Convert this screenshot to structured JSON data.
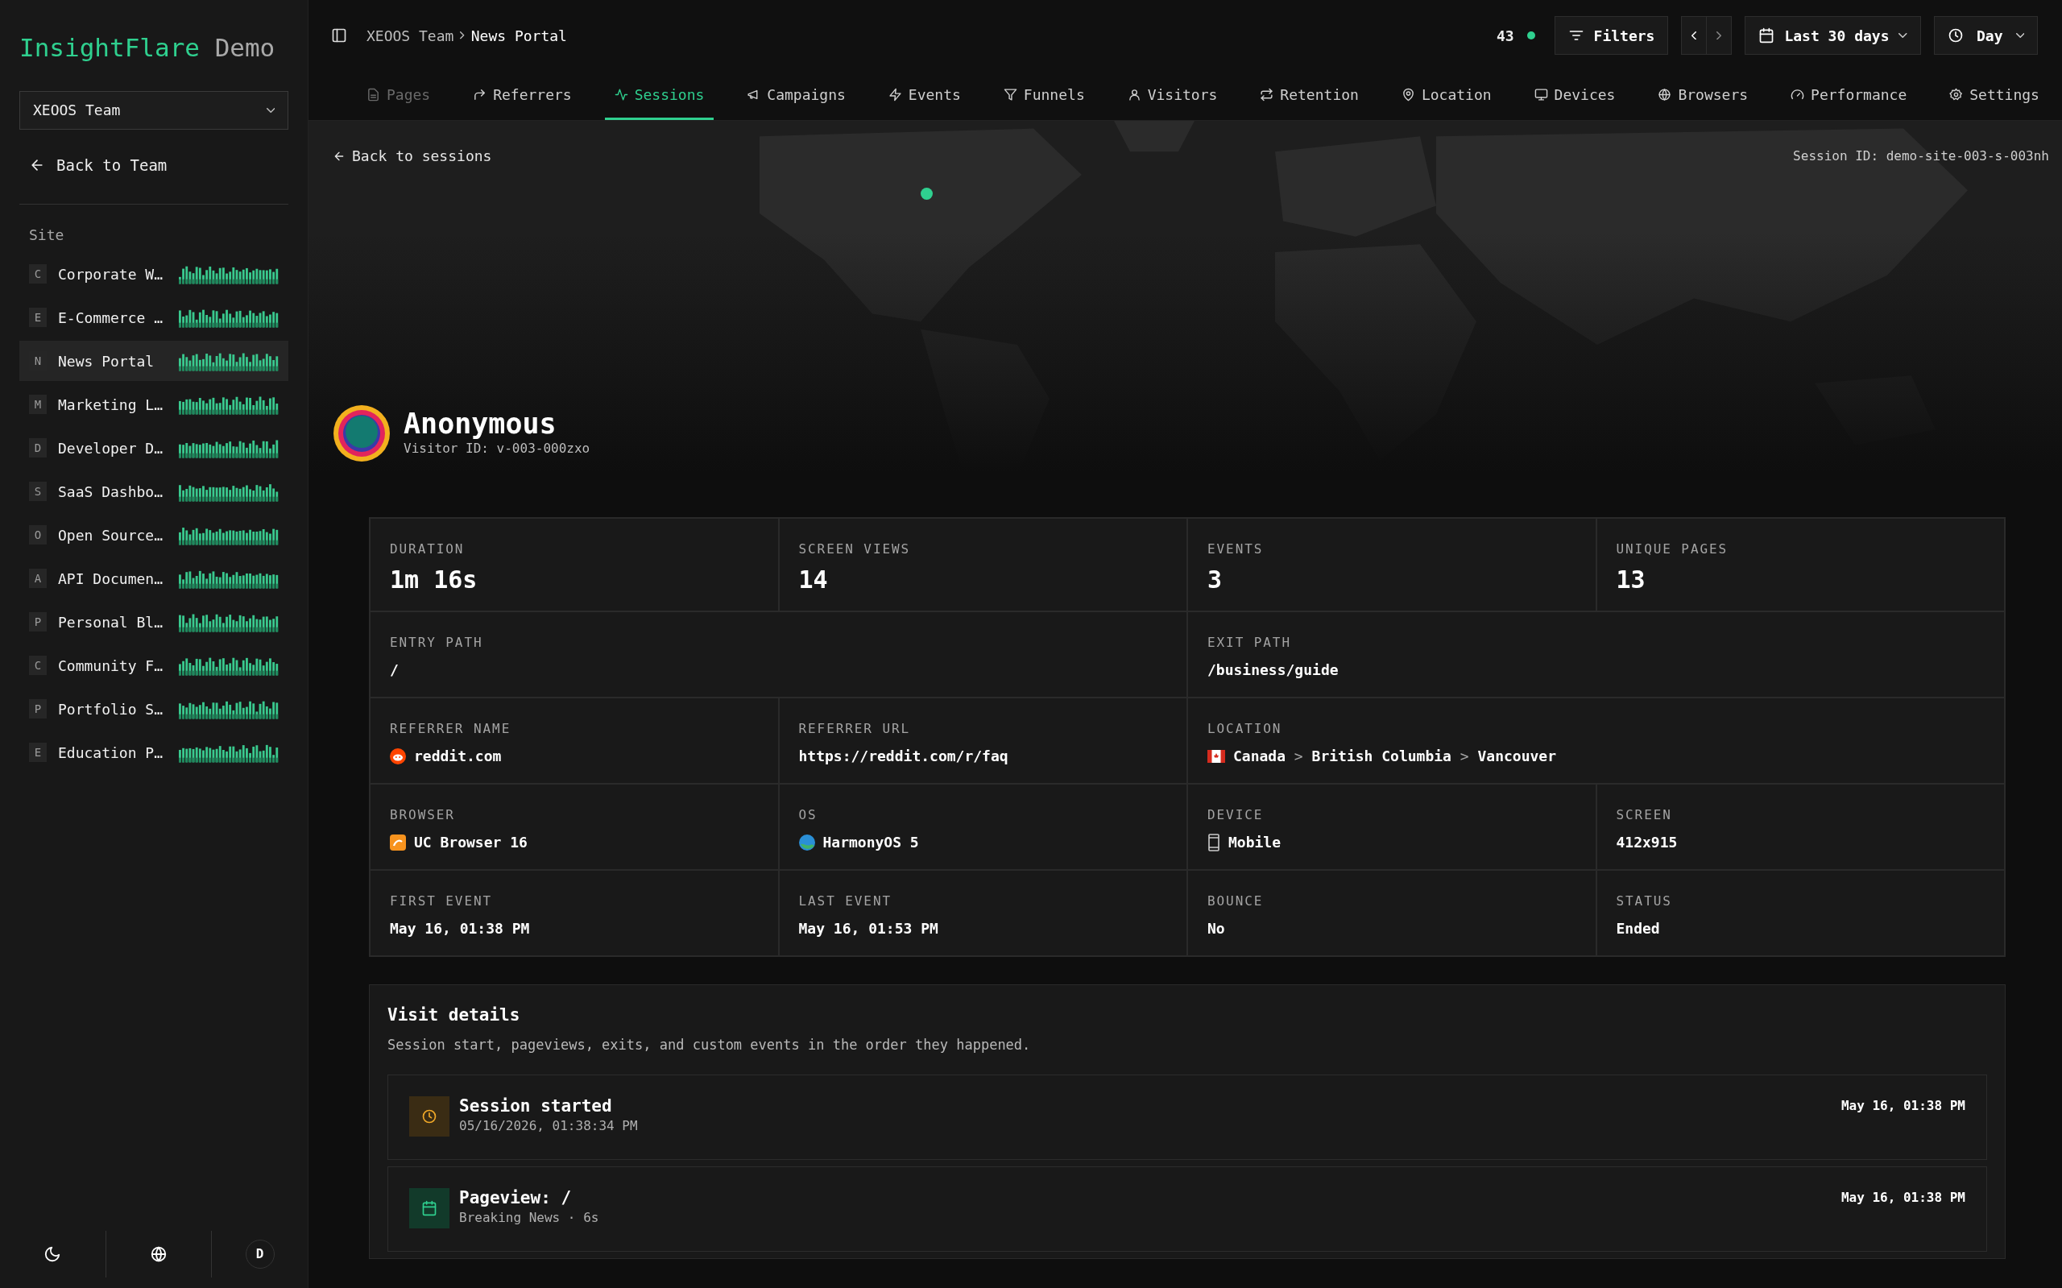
{
  "sidebar": {
    "logo": {
      "primary": "InsightFlare",
      "secondary": "Demo"
    },
    "team_select": {
      "value": "XEOOS Team"
    },
    "back_link": "Back to Team",
    "section": "Site",
    "sites": [
      {
        "letter": "C",
        "name": "Corporate W…",
        "selected": false
      },
      {
        "letter": "E",
        "name": "E-Commerce …",
        "selected": false
      },
      {
        "letter": "N",
        "name": "News Portal",
        "selected": true
      },
      {
        "letter": "M",
        "name": "Marketing L…",
        "selected": false
      },
      {
        "letter": "D",
        "name": "Developer D…",
        "selected": false
      },
      {
        "letter": "S",
        "name": "SaaS Dashbo…",
        "selected": false
      },
      {
        "letter": "O",
        "name": "Open Source…",
        "selected": false
      },
      {
        "letter": "A",
        "name": "API Documen…",
        "selected": false
      },
      {
        "letter": "P",
        "name": "Personal Bl…",
        "selected": false
      },
      {
        "letter": "C",
        "name": "Community F…",
        "selected": false
      },
      {
        "letter": "P",
        "name": "Portfolio S…",
        "selected": false
      },
      {
        "letter": "E",
        "name": "Education P…",
        "selected": false
      }
    ],
    "footer": {
      "avatar": "D",
      "dark_mode": true
    }
  },
  "topbar": {
    "breadcrumb": [
      "XEOOS Team",
      "News Portal"
    ],
    "online": "43",
    "filters": "Filters",
    "date_range": "Last 30 days",
    "interval": "Day"
  },
  "tabs": [
    {
      "label": "Pages",
      "kind": "pages",
      "selected": false,
      "dimmed": true
    },
    {
      "label": "Referrers",
      "kind": "referrers",
      "selected": false,
      "dimmed": false
    },
    {
      "label": "Sessions",
      "kind": "sessions",
      "selected": true,
      "dimmed": false
    },
    {
      "label": "Campaigns",
      "kind": "campaigns",
      "selected": false,
      "dimmed": false
    },
    {
      "label": "Events",
      "kind": "events",
      "selected": false,
      "dimmed": false
    },
    {
      "label": "Funnels",
      "kind": "funnels",
      "selected": false,
      "dimmed": false
    },
    {
      "label": "Visitors",
      "kind": "visitors",
      "selected": false,
      "dimmed": false
    },
    {
      "label": "Retention",
      "kind": "retention",
      "selected": false,
      "dimmed": false
    },
    {
      "label": "Location",
      "kind": "location",
      "selected": false,
      "dimmed": false
    },
    {
      "label": "Devices",
      "kind": "devices",
      "selected": false,
      "dimmed": false
    },
    {
      "label": "Browsers",
      "kind": "browsers",
      "selected": false,
      "dimmed": false
    },
    {
      "label": "Performance",
      "kind": "performance",
      "selected": false,
      "dimmed": false
    },
    {
      "label": "Settings",
      "kind": "settings",
      "selected": false,
      "dimmed": false
    }
  ],
  "session": {
    "back": "Back to sessions",
    "session_id": "Session ID: demo-site-003-s-003nh",
    "name": "Anonymous",
    "visitor_id": "Visitor ID: v-003-000zxo"
  },
  "stats": {
    "rows": [
      [
        {
          "label": "DURATION",
          "value": "1m 16s",
          "kind": "stat"
        },
        {
          "label": "SCREEN VIEWS",
          "value": "14",
          "kind": "stat"
        },
        {
          "label": "EVENTS",
          "value": "3",
          "kind": "stat"
        },
        {
          "label": "UNIQUE PAGES",
          "value": "13",
          "kind": "stat"
        }
      ],
      [
        {
          "label": "ENTRY PATH",
          "value": "/",
          "kind": "plain"
        },
        "",
        {
          "label": "EXIT PATH",
          "value": "/business/guide",
          "kind": "plain"
        },
        ""
      ],
      [
        {
          "label": "REFERRER NAME",
          "value": "reddit.com",
          "kind": "referrer"
        },
        {
          "label": "REFERRER URL",
          "value": "https://reddit.com/r/faq",
          "kind": "plain"
        },
        {
          "label": "LOCATION",
          "kind": "location",
          "parts": [
            "Canada",
            "British Columbia",
            "Vancouver"
          ],
          "separator": ">"
        },
        ""
      ],
      [
        {
          "label": "BROWSER",
          "value": "UC Browser 16",
          "kind": "browser"
        },
        {
          "label": "OS",
          "value": "HarmonyOS 5",
          "kind": "os"
        },
        {
          "label": "DEVICE",
          "value": "Mobile",
          "kind": "device"
        },
        {
          "label": "SCREEN",
          "value": "412x915",
          "kind": "plain"
        }
      ],
      [
        {
          "label": "FIRST EVENT",
          "value": "May 16, 01:38 PM",
          "kind": "plain"
        },
        {
          "label": "LAST EVENT",
          "value": "May 16, 01:53 PM",
          "kind": "plain"
        },
        {
          "label": "BOUNCE",
          "value": "No",
          "kind": "plain"
        },
        {
          "label": "STATUS",
          "value": "Ended",
          "kind": "plain"
        }
      ]
    ]
  },
  "visit_details": {
    "title": "Visit details",
    "subtitle": "Session start, pageviews, exits, and custom events in the order they happened.",
    "events": [
      {
        "kind": "session_start",
        "title": "Session started",
        "detail": "05/16/2026, 01:38:34 PM",
        "time": "May 16, 01:38 PM"
      },
      {
        "kind": "pageview",
        "title": "Pageview: /",
        "detail": "Breaking News · 6s",
        "time": "May 16, 01:38 PM"
      }
    ]
  }
}
